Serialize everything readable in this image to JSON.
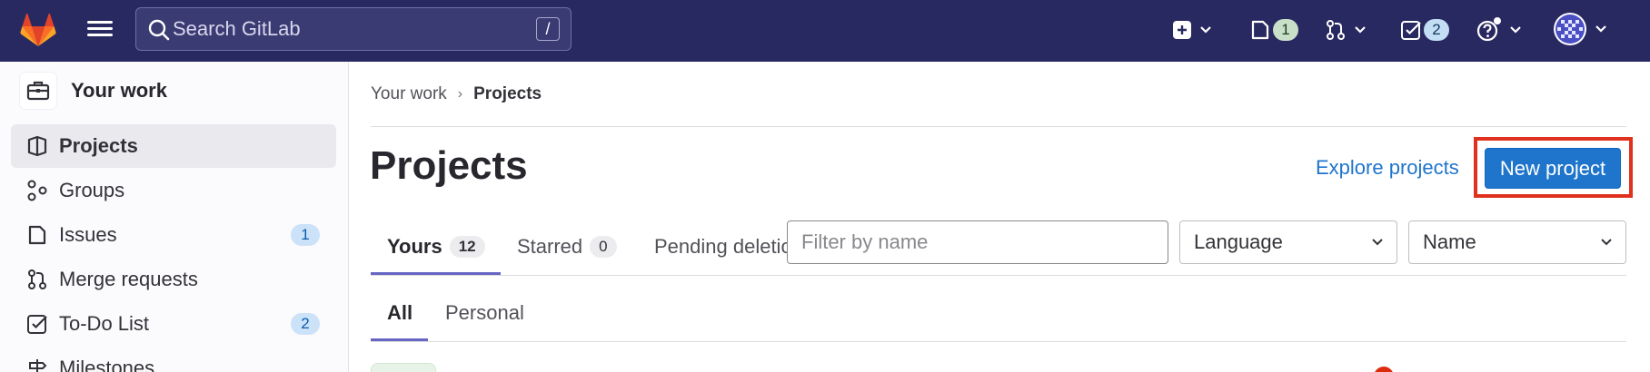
{
  "topbar": {
    "search_placeholder": "Search GitLab",
    "search_shortcut": "/",
    "issues_count": "1",
    "todos_count": "2"
  },
  "sidebar": {
    "title": "Your work",
    "items": [
      {
        "label": "Projects",
        "active": true,
        "icon": "project-icon"
      },
      {
        "label": "Groups",
        "icon": "group-icon"
      },
      {
        "label": "Issues",
        "count": "1",
        "icon": "issues-icon"
      },
      {
        "label": "Merge requests",
        "icon": "merge-request-icon"
      },
      {
        "label": "To-Do List",
        "count": "2",
        "icon": "todo-icon"
      },
      {
        "label": "Milestones",
        "icon": "milestone-icon"
      }
    ]
  },
  "breadcrumb": {
    "parent": "Your work",
    "current": "Projects"
  },
  "page": {
    "title": "Projects",
    "explore_label": "Explore projects",
    "new_project_label": "New project"
  },
  "tabs": [
    {
      "label": "Yours",
      "count": "12",
      "active": true
    },
    {
      "label": "Starred",
      "count": "0"
    },
    {
      "label": "Pending deletion"
    }
  ],
  "filters": {
    "name_placeholder": "Filter by name",
    "language_value": "Language",
    "sort_value": "Name"
  },
  "subtabs": [
    {
      "label": "All",
      "active": true
    },
    {
      "label": "Personal"
    }
  ],
  "colors": {
    "topbar": "#292961",
    "primary": "#1f75cb",
    "highlight": "#e0311f",
    "tab_underline": "#6666c4"
  }
}
